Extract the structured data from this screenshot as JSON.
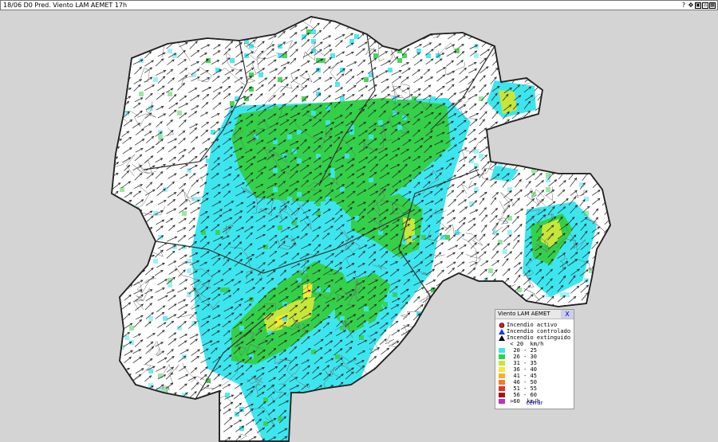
{
  "window": {
    "title": "18/06 D0 Pred. Viento LAM AEMET 17h",
    "tools": [
      {
        "name": "help-icon",
        "glyph": "?"
      },
      {
        "name": "pan-icon",
        "glyph": "✥"
      },
      {
        "name": "zoom-in-icon",
        "glyph": "▣"
      },
      {
        "name": "home-icon",
        "glyph": "⌂"
      },
      {
        "name": "layers-icon",
        "glyph": "▦"
      }
    ]
  },
  "legend": {
    "title": "Viento LAM AEMET",
    "close_x": "X",
    "close_link": "cerrar",
    "items": [
      {
        "label": "Incendio activo",
        "color": "#d81b1b",
        "kind": "circle"
      },
      {
        "label": "Incendio controlado",
        "color": "#1b3bd8",
        "kind": "triangle"
      },
      {
        "label": "Incendio extinguido",
        "color": "#000000",
        "kind": "triangle"
      },
      {
        "label": " < 20  km/h",
        "color": "#ffffff",
        "kind": "none"
      },
      {
        "label": "  20 - 25",
        "color": "#3de6ef",
        "kind": "swatch"
      },
      {
        "label": "  26 - 30",
        "color": "#35d04a",
        "kind": "swatch"
      },
      {
        "label": "  31 - 35",
        "color": "#c7e63a",
        "kind": "swatch"
      },
      {
        "label": "  36 - 40",
        "color": "#f3e936",
        "kind": "swatch"
      },
      {
        "label": "  41 - 45",
        "color": "#f4b12e",
        "kind": "swatch"
      },
      {
        "label": "  46 - 50",
        "color": "#f47c26",
        "kind": "swatch"
      },
      {
        "label": "  51 - 55",
        "color": "#e0342a",
        "kind": "swatch"
      },
      {
        "label": "  56 - 60",
        "color": "#a61515",
        "kind": "swatch"
      },
      {
        "label": " >60  km/h",
        "color": "#c22ec2",
        "kind": "swatch"
      }
    ]
  },
  "map": {
    "region_fill": "#ffffff",
    "outline_color": "#333333",
    "background": "#d4d4d4",
    "wind_zones": [
      {
        "level": "20 - 25",
        "color": "#3de6ef"
      },
      {
        "level": "26 - 30",
        "color": "#35d04a"
      },
      {
        "level": "31 - 35",
        "color": "#c7e63a"
      },
      {
        "level": "36 - 40",
        "color": "#f3e936"
      }
    ]
  }
}
